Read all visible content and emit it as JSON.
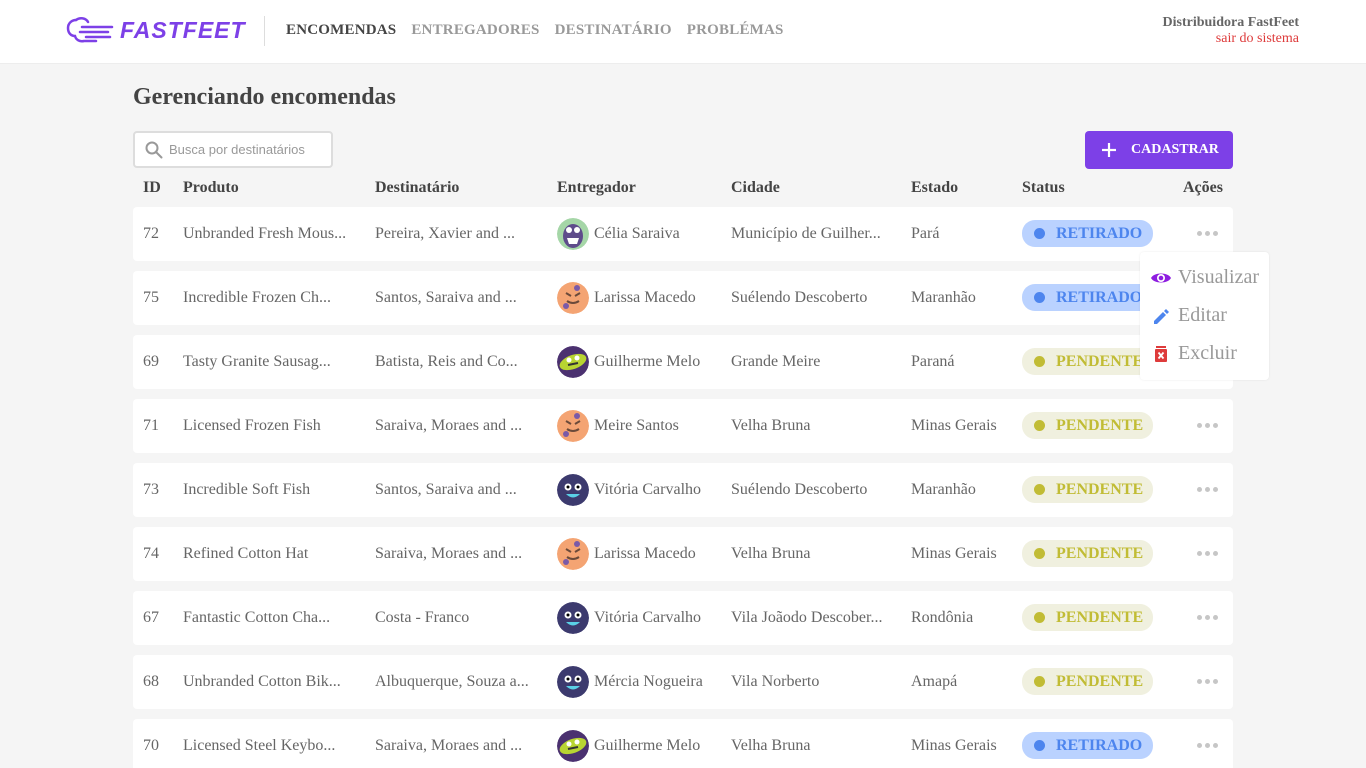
{
  "header": {
    "logo_text": "FASTFEET",
    "nav": [
      "ENCOMENDAS",
      "ENTREGADORES",
      "DESTINATÁRIO",
      "PROBLÉMAS"
    ],
    "active_nav": 0,
    "profile_name": "Distribuidora FastFeet",
    "logout_label": "sair do sistema"
  },
  "page": {
    "title": "Gerenciando encomendas",
    "search_placeholder": "Busca por destinatários",
    "add_label": "CADASTRAR"
  },
  "table": {
    "columns": [
      "ID",
      "Produto",
      "Destinatário",
      "Entregador",
      "Cidade",
      "Estado",
      "Status",
      "Ações"
    ],
    "rows": [
      {
        "id": "72",
        "product": "Unbranded Fresh Mous...",
        "recipient": "Pereira, Xavier and ...",
        "deliverer": "Célia Saraiva",
        "avatar": "green-monster-avatar",
        "city": "Município de Guilher...",
        "state": "Pará",
        "status": "RETIRADO"
      },
      {
        "id": "75",
        "product": "Incredible Frozen Ch...",
        "recipient": "Santos, Saraiva and ...",
        "deliverer": "Larissa Macedo",
        "avatar": "orange-monster-avatar",
        "city": "Suélendo Descoberto",
        "state": "Maranhão",
        "status": "RETIRADO"
      },
      {
        "id": "69",
        "product": "Tasty Granite Sausag...",
        "recipient": "Batista, Reis and Co...",
        "deliverer": "Guilherme Melo",
        "avatar": "purple-lime-avatar",
        "city": "Grande Meire",
        "state": "Paraná",
        "status": "PENDENTE"
      },
      {
        "id": "71",
        "product": "Licensed Frozen Fish",
        "recipient": "Saraiva, Moraes and ...",
        "deliverer": "Meire Santos",
        "avatar": "orange-monster-avatar",
        "city": "Velha Bruna",
        "state": "Minas Gerais",
        "status": "PENDENTE"
      },
      {
        "id": "73",
        "product": "Incredible Soft Fish",
        "recipient": "Santos, Saraiva and ...",
        "deliverer": "Vitória Carvalho",
        "avatar": "navy-monster-avatar",
        "city": "Suélendo Descoberto",
        "state": "Maranhão",
        "status": "PENDENTE"
      },
      {
        "id": "74",
        "product": "Refined Cotton Hat",
        "recipient": "Saraiva, Moraes and ...",
        "deliverer": "Larissa Macedo",
        "avatar": "orange-monster-avatar",
        "city": "Velha Bruna",
        "state": "Minas Gerais",
        "status": "PENDENTE"
      },
      {
        "id": "67",
        "product": "Fantastic Cotton Cha...",
        "recipient": "Costa - Franco",
        "deliverer": "Vitória Carvalho",
        "avatar": "navy-monster-avatar",
        "city": "Vila Joãodo Descober...",
        "state": "Rondônia",
        "status": "PENDENTE"
      },
      {
        "id": "68",
        "product": "Unbranded Cotton Bik...",
        "recipient": "Albuquerque, Souza a...",
        "deliverer": "Mércia Nogueira",
        "avatar": "navy-monster-avatar",
        "city": "Vila Norberto",
        "state": "Amapá",
        "status": "PENDENTE"
      },
      {
        "id": "70",
        "product": "Licensed Steel Keybo...",
        "recipient": "Saraiva, Moraes and ...",
        "deliverer": "Guilherme Melo",
        "avatar": "purple-lime-avatar",
        "city": "Velha Bruna",
        "state": "Minas Gerais",
        "status": "RETIRADO"
      }
    ]
  },
  "action_menu": {
    "items": [
      {
        "label": "Visualizar",
        "icon": "eye-icon",
        "color": "#8e1de0"
      },
      {
        "label": "Editar",
        "icon": "pencil-icon",
        "color": "#4d85ee"
      },
      {
        "label": "Excluir",
        "icon": "trash-icon",
        "color": "#de3b3b"
      }
    ]
  },
  "colors": {
    "brand": "#7d40e7",
    "retirado_bg": "#bad2ff",
    "retirado_fg": "#4d85ee",
    "pendente_bg": "#f0f0df",
    "pendente_fg": "#c1bc35"
  }
}
